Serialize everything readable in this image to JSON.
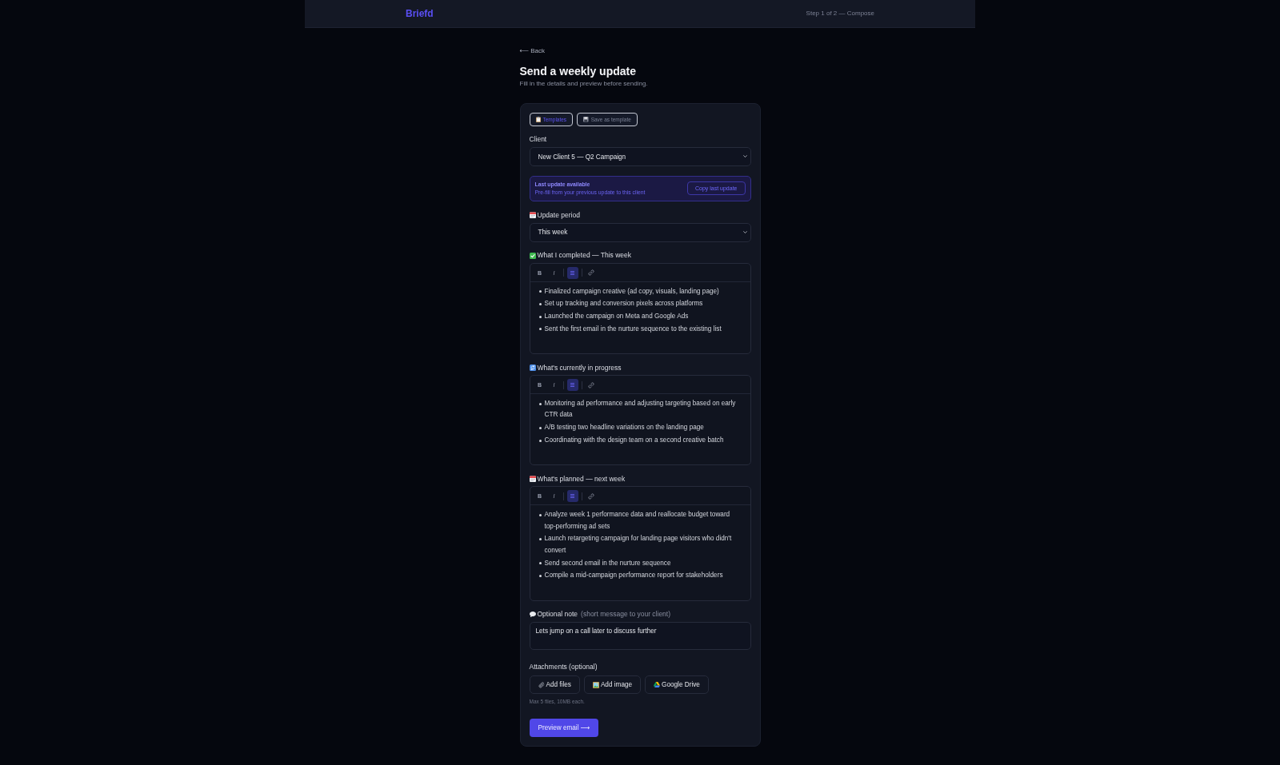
{
  "header": {
    "logo": "Briefd",
    "step": "Step 1 of 2 — Compose"
  },
  "back_link": "⟵ Back",
  "title": "Send a weekly update",
  "subtitle": "Fill in the details and preview before sending.",
  "template_buttons": [
    {
      "label": "Templates",
      "disabled": false
    },
    {
      "label": "Save as template",
      "disabled": true
    }
  ],
  "client": {
    "label": "Client",
    "value": "New Client 5 — Q2 Campaign"
  },
  "last_update_notice": {
    "title": "Last update available",
    "text": "Pre-fill from your previous update to this client",
    "button": "Copy last update"
  },
  "update_period": {
    "label": "Update period",
    "value": "This week"
  },
  "sections": [
    {
      "label": "What I completed — This week",
      "toolbar": [
        {
          "kind": "bold",
          "label": "B",
          "on": false
        },
        {
          "kind": "italic",
          "label": "I",
          "on": false
        },
        {
          "kind": "list",
          "on": true
        },
        {
          "kind": "link",
          "on": false
        }
      ],
      "items": [
        "Finalized campaign creative (ad copy, visuals, landing page)",
        "Set up tracking and conversion pixels across platforms",
        "Launched the campaign on Meta and Google Ads",
        "Sent the first email in the nurture sequence to the existing list"
      ]
    },
    {
      "label": "What's currently in progress",
      "toolbar": [
        {
          "kind": "bold",
          "label": "B",
          "on": false
        },
        {
          "kind": "italic",
          "label": "I",
          "on": false
        },
        {
          "kind": "list",
          "on": true
        },
        {
          "kind": "link",
          "on": false
        }
      ],
      "items": [
        "Monitoring ad performance and adjusting targeting based on early CTR data",
        "A/B testing two headline variations on the landing page",
        "Coordinating with the design team on a second creative batch"
      ]
    },
    {
      "label": "What's planned — next week",
      "toolbar": [
        {
          "kind": "bold",
          "label": "B",
          "on": false
        },
        {
          "kind": "italic",
          "label": "I",
          "on": false
        },
        {
          "kind": "list",
          "on": true
        },
        {
          "kind": "link",
          "on": false
        }
      ],
      "items": [
        "Analyze week 1 performance data and reallocate budget toward top-performing ad sets",
        "Launch retargeting campaign for landing page visitors who didn't convert",
        "Send second email in the nurture sequence",
        "Compile a mid-campaign performance report for stakeholders"
      ]
    }
  ],
  "note": {
    "label": "Optional note",
    "hint": "(short message to your client)",
    "value": "Lets jump on a call later to discuss further"
  },
  "attachments": {
    "label": "Attachments (optional)",
    "buttons": [
      "Add files",
      "Add image",
      "Google Drive"
    ],
    "hint": "Max 5 files, 10MB each."
  },
  "preview_button": "Preview email ⟶"
}
